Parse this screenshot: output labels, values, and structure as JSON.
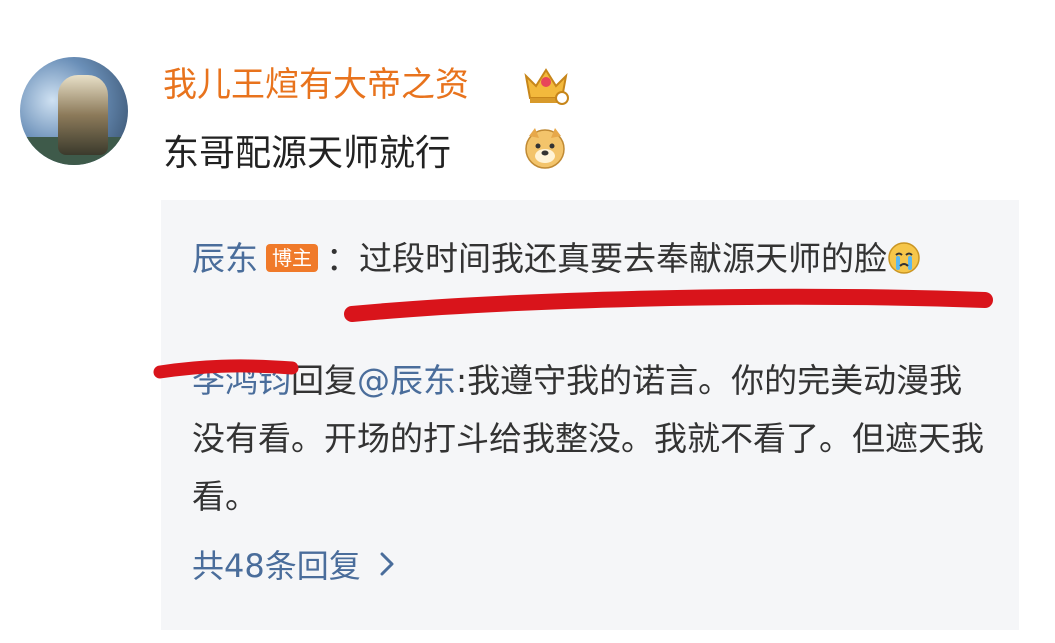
{
  "comment": {
    "author": "我儿王煊有大帝之资",
    "text": "东哥配源天师就行",
    "author_badge_icon": "crown-icon",
    "text_emoji": "doge-emoji-icon"
  },
  "replies": [
    {
      "author": "辰东",
      "badge": "博主",
      "separator": "：",
      "text": "过段时间我还真要去奉献源天师的脸",
      "emoji": "crying-emoji-icon"
    },
    {
      "author": "李鸿钧",
      "reply_word": "回复",
      "mention": "@辰东",
      "separator": ":",
      "text": "我遵守我的诺言。你的完美动漫我没有看。开场的打斗给我整没。我就不看了。但遮天我看。"
    }
  ],
  "more_replies": {
    "label": "共48条回复",
    "icon": "chevron-right-icon"
  },
  "colors": {
    "author": "#e8731d",
    "link": "#4a6d9b",
    "badge": "#f07a2a",
    "annotation": "#d9141b",
    "reply_bg": "#f5f6f8"
  }
}
